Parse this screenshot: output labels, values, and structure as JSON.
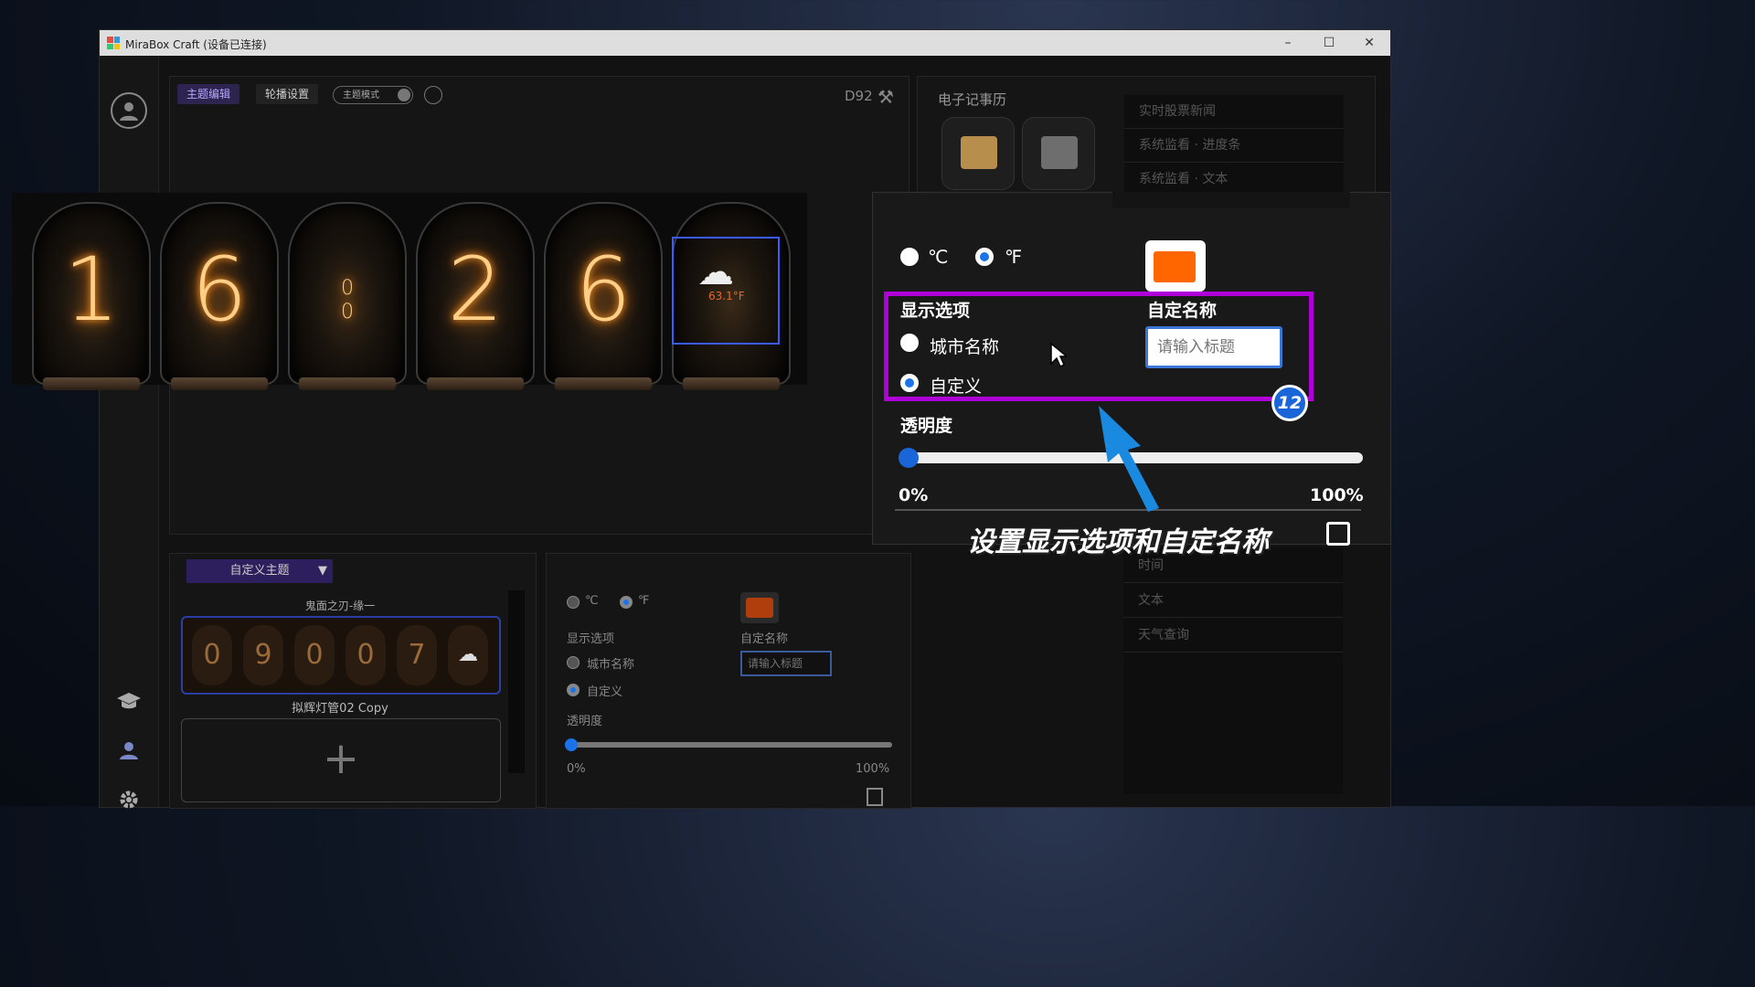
{
  "app": {
    "title": "MiraBox Craft   (设备已连接)"
  },
  "tabs": {
    "theme_edit": "主题编辑",
    "carousel": "轮播设置",
    "theme_mode": "主题模式"
  },
  "device": {
    "model": "D92"
  },
  "digits": [
    "1",
    "6",
    "0\n0",
    "2",
    "6"
  ],
  "weather_tube": {
    "temp": "63.1°F"
  },
  "calendar": {
    "title": "电子记事历"
  },
  "right_list": {
    "top": [
      "实时股票新闻",
      "系统监看 · 进度条",
      "系统监看 · 文本"
    ],
    "bottom": [
      "时间",
      "文本",
      "天气查询"
    ]
  },
  "zoom_panel": {
    "celsius": "℃",
    "fahrenheit": "℉",
    "display_options": "显示选项",
    "custom_name": "自定名称",
    "city_name": "城市名称",
    "custom": "自定义",
    "input_placeholder": "请输入标题",
    "badge": "12",
    "opacity": "透明度",
    "min": "0%",
    "max": "100%",
    "swatch_color": "#ff6600",
    "opacity_value": 0
  },
  "caption": "设置显示选项和自定名称",
  "theme_list": {
    "dropdown": "自定义主题",
    "theme1": "鬼面之刃-缘一",
    "theme2": "拟辉灯管02 Copy",
    "theme2_digits": [
      "0",
      "9",
      "0",
      "0",
      "7"
    ],
    "add": "+"
  },
  "small_panel": {
    "celsius": "℃",
    "fahrenheit": "℉",
    "display_options": "显示选项",
    "custom_name": "自定名称",
    "city_name": "城市名称",
    "custom": "自定义",
    "input_placeholder": "请输入标题",
    "opacity": "透明度",
    "min": "0%",
    "max": "100%"
  }
}
